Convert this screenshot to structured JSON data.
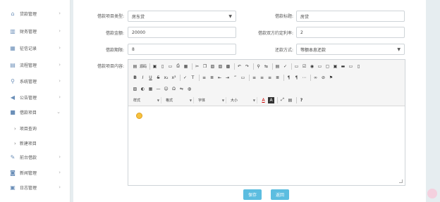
{
  "sidebar": {
    "items": [
      {
        "label": "贷款管理",
        "icon": "home-icon",
        "arrow": "›"
      },
      {
        "label": "财务管理",
        "icon": "bar-chart-icon",
        "arrow": "›"
      },
      {
        "label": "征信记录",
        "icon": "grid-icon",
        "arrow": "›"
      },
      {
        "label": "流程管理",
        "icon": "list-icon",
        "arrow": "›"
      },
      {
        "label": "系统管理",
        "icon": "wrench-icon",
        "arrow": "›"
      },
      {
        "label": "公告管理",
        "icon": "megaphone-icon",
        "arrow": "›"
      },
      {
        "label": "借款项目",
        "icon": "tiles-icon",
        "arrow": "⌄"
      }
    ],
    "subitems": [
      {
        "label": "项目查询",
        "chev": "›"
      },
      {
        "label": "新建项目",
        "chev": "›"
      }
    ],
    "items2": [
      {
        "label": "前台借款",
        "icon": "edit-icon",
        "arrow": "›"
      },
      {
        "label": "新闻管理",
        "icon": "camera-icon",
        "arrow": "›"
      },
      {
        "label": "日志管理",
        "icon": "log-icon",
        "arrow": "›"
      }
    ]
  },
  "form": {
    "type_label": "借款项目类型:",
    "type_value": "房东贷",
    "title_label": "借款标题:",
    "title_value": "房贷",
    "amount_label": "借款金额:",
    "amount_value": "20000",
    "rate_label": "借款双方约定利率:",
    "rate_value": "2",
    "term_label": "借款期限:",
    "term_value": "8",
    "repay_label": "还款方式:",
    "repay_value": "等额本息还款",
    "content_label": "借款项目内容:"
  },
  "editor": {
    "source_label": "源码",
    "combos": [
      {
        "label": "样式"
      },
      {
        "label": "格式"
      },
      {
        "label": "字体"
      },
      {
        "label": "大小"
      }
    ]
  },
  "buttons": {
    "save": "保存",
    "back": "返回"
  },
  "colors": {
    "accent": "#5cbde0",
    "sidebar_icon": "#6b8fb8"
  }
}
